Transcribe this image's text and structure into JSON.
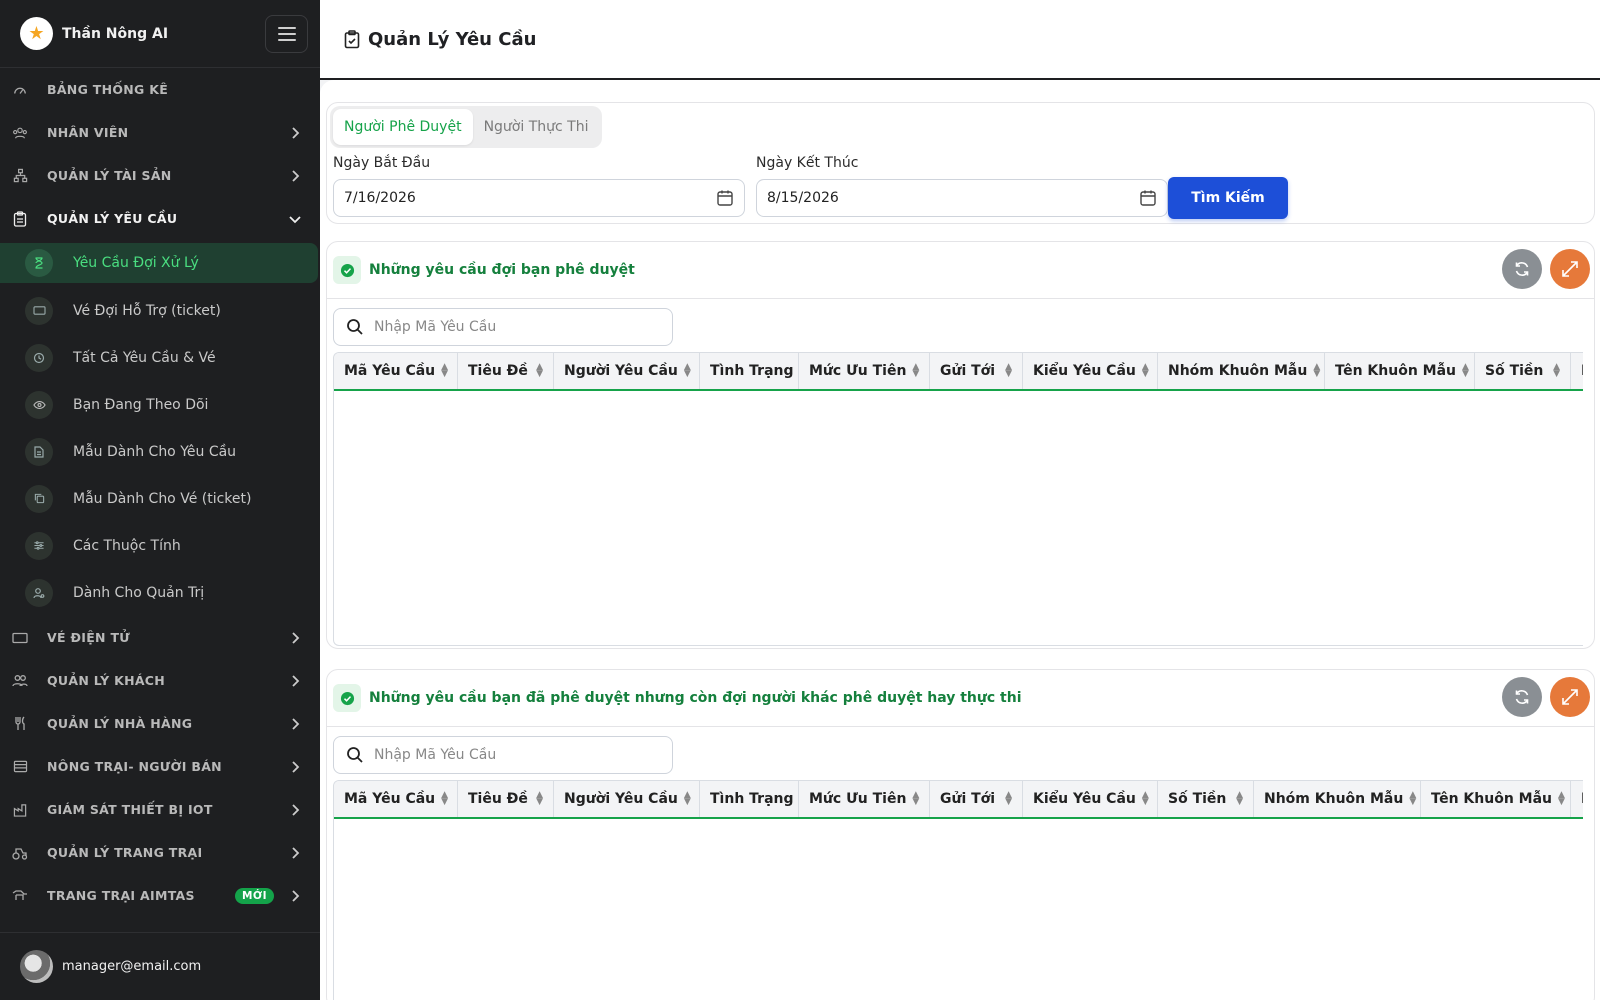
{
  "app": {
    "brand": "Thần Nông AI",
    "user_email": "manager@email.com"
  },
  "sidebar": {
    "items": [
      {
        "label": "BẢNG THỐNG KÊ",
        "icon": "gauge-icon",
        "chevron": false
      },
      {
        "label": "NHÂN VIÊN",
        "icon": "staff-icon",
        "chevron": true
      },
      {
        "label": "QUẢN LÝ TÀI SẢN",
        "icon": "hierarchy-icon",
        "chevron": true
      },
      {
        "label": "QUẢN LÝ YÊU CẦU",
        "icon": "clipboard-icon",
        "chevron": "down"
      }
    ],
    "sub_items": [
      {
        "label": "Yêu Cầu Đợi Xử Lý",
        "icon": "hourglass-icon",
        "active": true
      },
      {
        "label": "Vé Đợi Hỗ Trợ (ticket)",
        "icon": "ticket-icon"
      },
      {
        "label": "Tất Cả Yêu Cầu & Vé",
        "icon": "history-icon"
      },
      {
        "label": "Bạn Đang Theo Dõi",
        "icon": "eye-icon"
      },
      {
        "label": "Mẫu Dành Cho Yêu Cầu",
        "icon": "document-icon"
      },
      {
        "label": "Mẫu Dành Cho Vé (ticket)",
        "icon": "copy-icon"
      },
      {
        "label": "Các Thuộc Tính",
        "icon": "sliders-icon"
      },
      {
        "label": "Dành Cho Quản Trị",
        "icon": "admin-user-icon"
      }
    ],
    "items_after": [
      {
        "label": "VÉ ĐIỆN TỬ",
        "icon": "ticket-icon"
      },
      {
        "label": "QUẢN LÝ KHÁCH",
        "icon": "users-icon"
      },
      {
        "label": "QUẢN LÝ NHÀ HÀNG",
        "icon": "utensils-icon"
      },
      {
        "label": "NÔNG TRẠI- NGƯỜI BÁN",
        "icon": "store-icon"
      },
      {
        "label": "GIÁM SÁT THIẾT BỊ IOT",
        "icon": "factory-icon"
      },
      {
        "label": "QUẢN LÝ TRANG TRẠI",
        "icon": "tractor-icon"
      },
      {
        "label": "TRANG TRẠI AIMTAS",
        "icon": "cow-icon",
        "badge": "MỚI"
      }
    ]
  },
  "header": {
    "title": "Quản Lý Yêu Cầu"
  },
  "filters": {
    "tabs": [
      "Người Phê Duyệt",
      "Người Thực Thi"
    ],
    "active_tab": 0,
    "start_label": "Ngày Bắt Đầu",
    "start_value": "7/16/2026",
    "end_label": "Ngày Kết Thúc",
    "end_value": "8/15/2026",
    "search_button": "Tìm Kiếm"
  },
  "panel1": {
    "title": "Những yêu cầu đợi bạn phê duyệt",
    "search_placeholder": "Nhập Mã Yêu Cầu",
    "columns": [
      "Mã Yêu Cầu",
      "Tiêu Đề",
      "Người Yêu Cầu",
      "Tình Trạng",
      "Mức Ưu Tiên",
      "Gửi Tới",
      "Kiểu Yêu Cầu",
      "Nhóm Khuôn Mẫu",
      "Tên Khuôn Mẫu",
      "Số Tiền",
      "N"
    ],
    "rows": []
  },
  "panel2": {
    "title": "Những yêu cầu bạn đã phê duyệt nhưng còn đợi người khác phê duyệt hay thực thi",
    "search_placeholder": "Nhập Mã Yêu Cầu",
    "columns": [
      "Mã Yêu Cầu",
      "Tiêu Đề",
      "Người Yêu Cầu",
      "Tình Trạng",
      "Mức Ưu Tiên",
      "Gửi Tới",
      "Kiểu Yêu Cầu",
      "Số Tiền",
      "Nhóm Khuôn Mẫu",
      "Tên Khuôn Mẫu",
      "N"
    ],
    "rows": []
  },
  "colors": {
    "accent": "#16a34a",
    "primary_button": "#1d4fd8",
    "sidebar_bg": "#1e1f21",
    "expand_button": "#e6793a"
  }
}
